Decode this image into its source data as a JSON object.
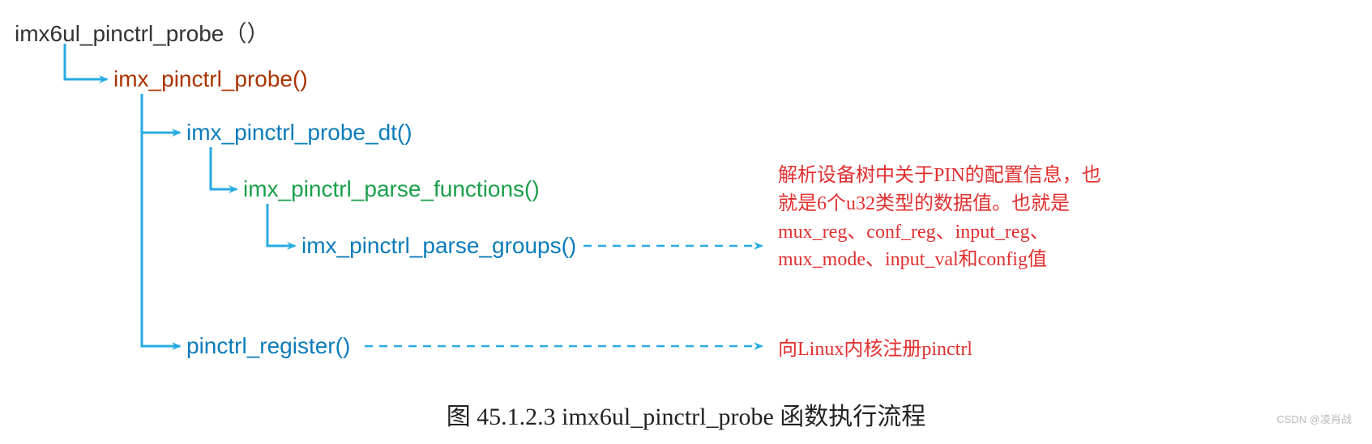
{
  "tree": {
    "root": "imx6ul_pinctrl_probe（）",
    "level1": "imx_pinctrl_probe()",
    "level2a": "imx_pinctrl_probe_dt()",
    "level3": "imx_pinctrl_parse_functions()",
    "level4": "imx_pinctrl_parse_groups()",
    "level2b": "pinctrl_register()"
  },
  "descriptions": {
    "parse_groups": "解析设备树中关于PIN的配置信息，也就是6个u32类型的数据值。也就是mux_reg、conf_reg、input_reg、mux_mode、input_val和config值",
    "register": "向Linux内核注册pinctrl"
  },
  "caption": "图 45.1.2.3 imx6ul_pinctrl_probe 函数执行流程",
  "watermark": "CSDN @凌肖战",
  "colors": {
    "tree_line": "#29abe2",
    "dashed_line": "#29abe2",
    "desc_text": "#e03030",
    "root_text": "#333333",
    "brown_text": "#aa3300",
    "blue_text": "#0b7cbb",
    "green_text": "#1a9f4a"
  }
}
